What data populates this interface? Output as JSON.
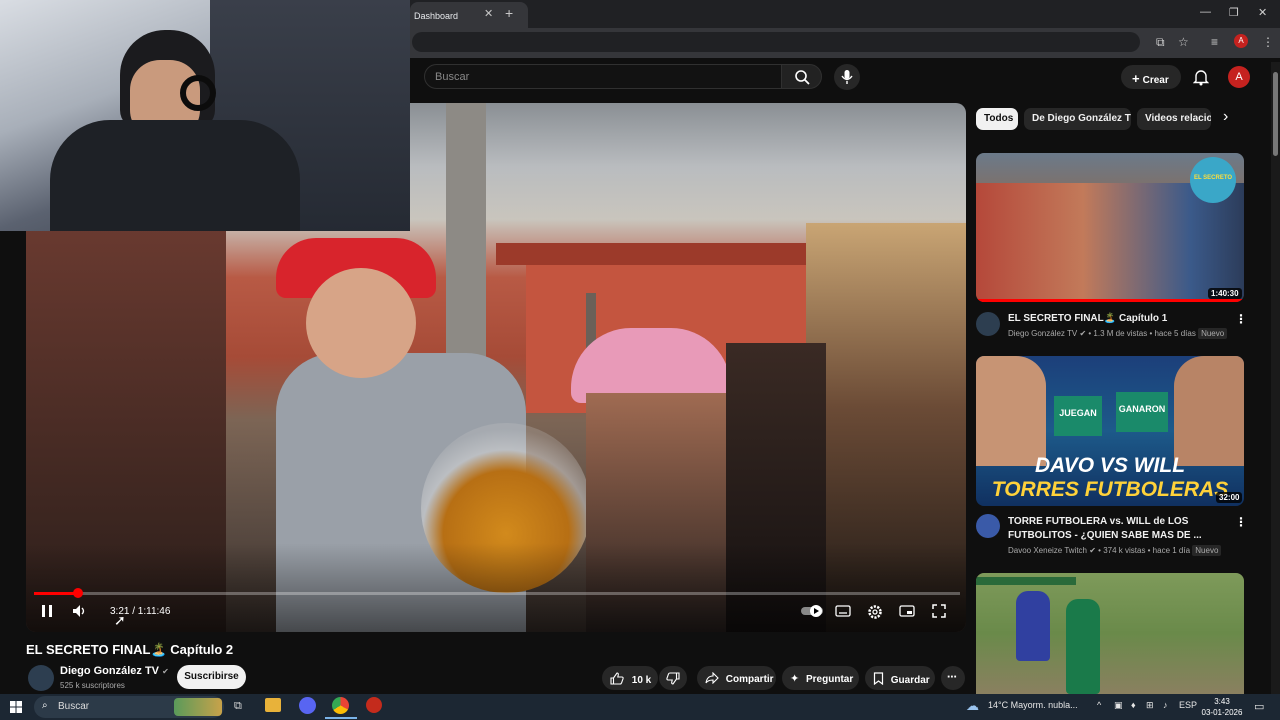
{
  "browser": {
    "tab_title": "Dashboard",
    "tab_close": "✕",
    "new_tab": "+",
    "window_controls": [
      "—",
      "❐",
      "✕"
    ],
    "profile_initial": "A"
  },
  "youtube": {
    "search_placeholder": "Buscar",
    "create_label": "Crear",
    "avatar_initial": "A"
  },
  "player": {
    "current_time": "3:21",
    "duration": "1:11:46",
    "time_display": "3:21 / 1:11:46",
    "progress_fraction": 0.047,
    "state": "playing"
  },
  "video": {
    "title": "EL SECRETO FINAL🏝️ Capítulo 2",
    "channel_name": "Diego González TV",
    "verified": "✔",
    "subscribers": "525 k suscriptores",
    "subscribe_label": "Suscribirse",
    "likes": "10 k",
    "share_label": "Compartir",
    "ask_label": "Preguntar",
    "save_label": "Guardar",
    "more": "⋯"
  },
  "chips": {
    "items": [
      {
        "label": "Todos",
        "active": true
      },
      {
        "label": "De Diego González TV",
        "active": false
      },
      {
        "label": "Videos relacion",
        "active": false
      }
    ],
    "next": "›"
  },
  "recommendations": [
    {
      "title": "EL SECRETO FINAL🏝️ Capítulo 1",
      "channel": "Diego González TV ✔",
      "meta": "• 1.3 M de vistas • hace 5 días",
      "badge": "Nuevo",
      "duration": "1:40:30",
      "thumb_text": "EL SECRETO"
    },
    {
      "title": "TORRE FUTBOLERA vs. WILL de LOS FUTBOLITOS - ¿QUIEN SABE MAS DE ...",
      "channel": "Davoo Xeneize Twitch ✔",
      "meta": "• 374 k vistas • hace 1 día",
      "badge": "Nuevo",
      "duration": "32:00",
      "thumb_text_1": "DAVO VS WILL",
      "thumb_text_2": "TORRES FUTBOLERAS",
      "thumb_sign_1": "JUEGAN",
      "thumb_sign_2": "GANARON"
    },
    {
      "title": "",
      "channel": "",
      "meta": "",
      "duration": ""
    }
  ],
  "taskbar": {
    "search_label": "Buscar",
    "weather": "14°C  Mayorm. nubla...",
    "language": "ESP",
    "time": "3:43",
    "date": "03-01-2026"
  },
  "colors": {
    "accent_red": "#ff0000",
    "background": "#0f0f0f",
    "chip_active": "#f1f1f1",
    "chip_inactive": "#272727"
  }
}
